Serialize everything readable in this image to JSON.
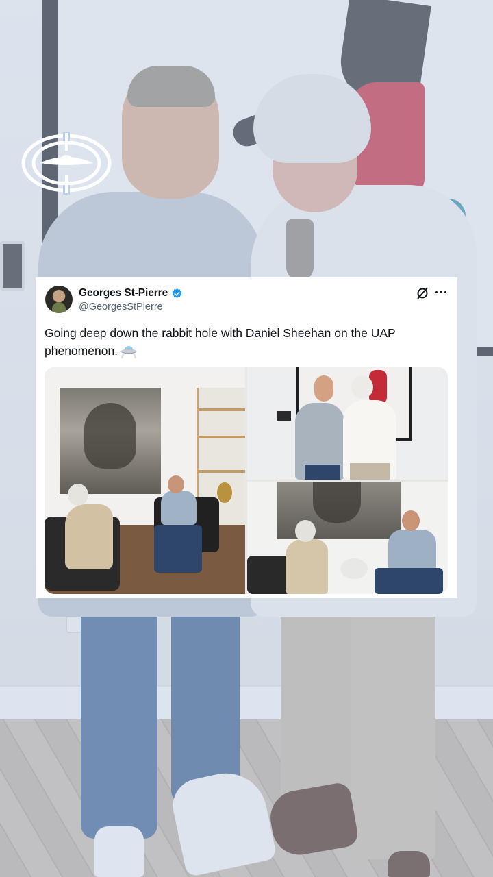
{
  "brand": {
    "logo_icon": "ufo-orbit-logo-icon",
    "logo_color": "#ffffff"
  },
  "tweet": {
    "author_name": "Georges St-Pierre",
    "author_handle": "@GeorgesStPierre",
    "verified": true,
    "verified_color": "#1d9bf0",
    "text": "Going deep down the rabbit hole with Daniel Sheehan on the UAP phenomenon.",
    "emoji_icon": "flying-saucer-icon",
    "header_icons": [
      "grok-icon",
      "more-options-icon"
    ],
    "media_count": 3,
    "media": [
      {
        "name": "media-interview-wide",
        "icon": "photo-icon"
      },
      {
        "name": "media-standing-portrait",
        "icon": "photo-icon"
      },
      {
        "name": "media-interview-seated",
        "icon": "photo-icon"
      }
    ]
  },
  "colors": {
    "text_primary": "#0f1419",
    "text_secondary": "#536471",
    "card_background": "#ffffff"
  }
}
